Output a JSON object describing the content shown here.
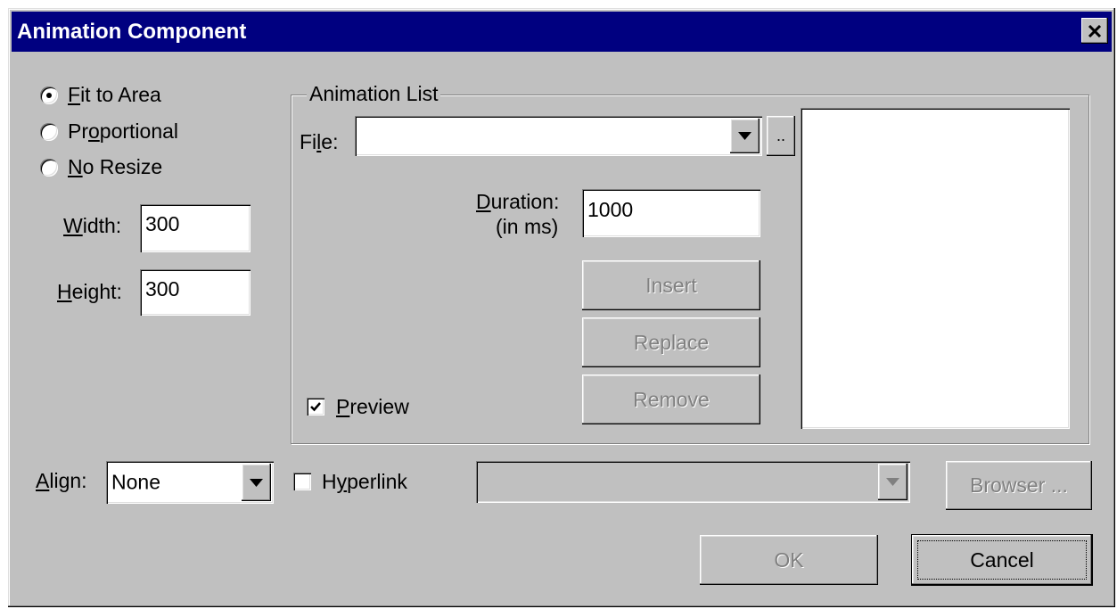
{
  "window": {
    "title": "Animation Component",
    "close_icon": "close-icon"
  },
  "sizing": {
    "options": [
      {
        "pre": "",
        "key": "F",
        "post": "it to Area",
        "selected": true
      },
      {
        "pre": "Pr",
        "key": "o",
        "post": "portional",
        "selected": false
      },
      {
        "pre": "",
        "key": "N",
        "post": "o Resize",
        "selected": false
      }
    ],
    "width_label": {
      "key": "W",
      "post": "idth:"
    },
    "width_value": "300",
    "height_label": {
      "key": "H",
      "post": "eight:"
    },
    "height_value": "300"
  },
  "animation_list": {
    "group_label": "Animation List",
    "file_label": {
      "pre": "Fi",
      "key": "l",
      "post": "e:"
    },
    "file_value": "",
    "browse_small_label": "..",
    "duration_label": {
      "key": "D",
      "post": "uration:"
    },
    "duration_sub_label": "(in ms)",
    "duration_value": "1000",
    "insert_label": "Insert",
    "replace_label": "Replace",
    "remove_label": "Remove",
    "preview_label": {
      "key": "P",
      "post": "review"
    },
    "preview_checked": true
  },
  "bottom": {
    "align_label": {
      "key": "A",
      "post": "lign:"
    },
    "align_value": "None",
    "hyperlink_label": {
      "pre": "H",
      "key": "y",
      "post": "perlink"
    },
    "hyperlink_checked": false,
    "hyperlink_value": "",
    "browser_label": "Browser ..."
  },
  "actions": {
    "ok_label": "OK",
    "cancel_label": "Cancel"
  }
}
